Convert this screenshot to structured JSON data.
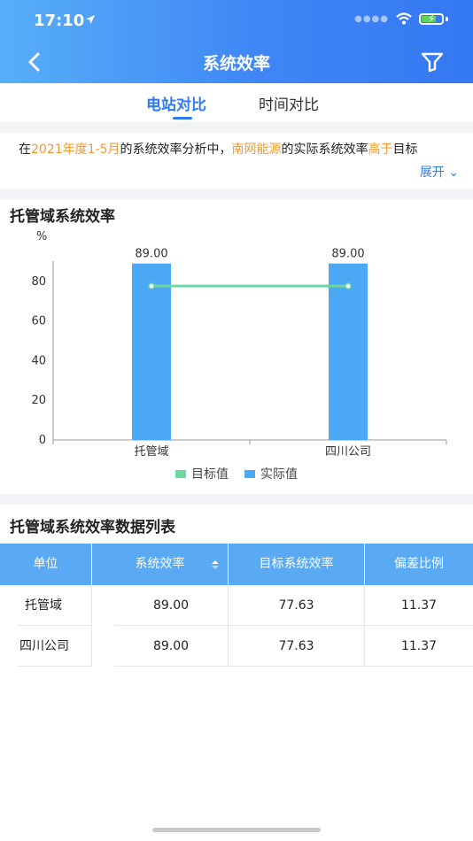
{
  "status_bar": {
    "time": "17:10"
  },
  "nav": {
    "title": "系统效率"
  },
  "tabs": [
    {
      "label": "电站对比"
    },
    {
      "label": "时间对比"
    }
  ],
  "summary": {
    "p1": "在",
    "period": "2021年度1-5月",
    "p2": "的系统效率分析中，",
    "company": "南网能源",
    "p3": "的实际系统效率",
    "comparison": "高于",
    "p4": "目标",
    "expand_label": "展开"
  },
  "chart_section_title": "托管域系统效率",
  "chart_data": {
    "type": "bar",
    "y_unit": "%",
    "categories": [
      "托管域",
      "四川公司"
    ],
    "series": [
      {
        "name": "实际值",
        "type": "bar",
        "values": [
          89.0,
          89.0
        ],
        "labels": [
          "89.00",
          "89.00"
        ],
        "color": "#4aa8f5"
      },
      {
        "name": "目标值",
        "type": "line",
        "values": [
          77.63,
          77.63
        ],
        "color": "#6fd6a3"
      }
    ],
    "y_ticks": [
      0,
      20,
      40,
      60,
      80
    ],
    "ylim": [
      0,
      100
    ],
    "legend_position": "bottom"
  },
  "table_section_title": "托管域系统效率数据列表",
  "table": {
    "headers": [
      "单位",
      "系统效率",
      "目标系统效率",
      "偏差比例"
    ],
    "rows": [
      [
        "托管域",
        "89.00",
        "77.63",
        "11.37"
      ],
      [
        "四川公司",
        "89.00",
        "77.63",
        "11.37"
      ]
    ]
  },
  "colors": {
    "accent": "#2e7bf0",
    "header_blue": "#3f86f5",
    "highlight": "#f39a2f",
    "table_header": "#5aaaf3"
  }
}
